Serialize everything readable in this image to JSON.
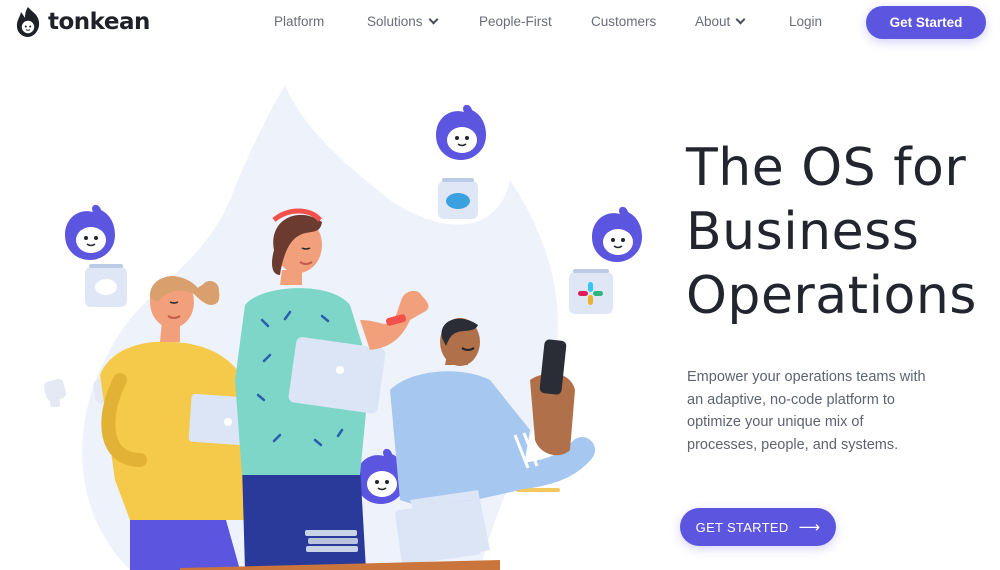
{
  "brand": {
    "name": "tonkean",
    "accent": "#5c55e0"
  },
  "nav": {
    "items": [
      {
        "label": "Platform",
        "has_dropdown": false
      },
      {
        "label": "Solutions",
        "has_dropdown": true
      },
      {
        "label": "People-First",
        "has_dropdown": false
      },
      {
        "label": "Customers",
        "has_dropdown": false
      },
      {
        "label": "About",
        "has_dropdown": true
      },
      {
        "label": "Login",
        "has_dropdown": false
      }
    ],
    "cta_label": "Get Started"
  },
  "hero": {
    "title_lines": [
      "The OS for",
      "Business",
      "Operations"
    ],
    "description": "Empower your operations teams with an adaptive, no-code platform to optimize your unique mix of processes, people, and systems.",
    "cta_label": "GET STARTED",
    "cta_icon": "arrow-right-icon"
  },
  "illustration": {
    "icons": [
      "mascot-icon",
      "chat-bubble-icon",
      "salesforce-icon",
      "slack-icon",
      "zendesk-icon"
    ]
  }
}
